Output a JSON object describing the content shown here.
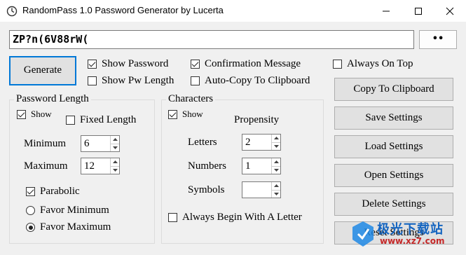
{
  "window": {
    "title": "RandomPass 1.0 Password Generator by Lucerta",
    "icons": [
      "app-icon",
      "minimize-icon",
      "maximize-icon",
      "close-icon"
    ]
  },
  "password": {
    "value": "ZP?n(6V88rW(",
    "reveal_button": "••"
  },
  "actions": {
    "generate": "Generate",
    "copy": "Copy To Clipboard",
    "save": "Save Settings",
    "load": "Load Settings",
    "open": "Open Settings",
    "delete": "Delete Settings",
    "reset": "Reset Settings"
  },
  "options": {
    "show_password": {
      "label": "Show Password",
      "checked": true
    },
    "show_pw_length": {
      "label": "Show Pw Length",
      "checked": false
    },
    "confirmation_message": {
      "label": "Confirmation Message",
      "checked": true
    },
    "auto_copy": {
      "label": "Auto-Copy To Clipboard",
      "checked": false
    },
    "always_on_top": {
      "label": "Always On Top",
      "checked": false
    }
  },
  "password_length": {
    "title": "Password Length",
    "show": {
      "label": "Show",
      "checked": true
    },
    "fixed_length": {
      "label": "Fixed Length",
      "checked": false
    },
    "minimum_label": "Minimum",
    "minimum_value": "6",
    "maximum_label": "Maximum",
    "maximum_value": "12",
    "parabolic": {
      "label": "Parabolic",
      "checked": true
    },
    "favor_minimum": {
      "label": "Favor Minimum",
      "selected": false
    },
    "favor_maximum": {
      "label": "Favor Maximum",
      "selected": true
    }
  },
  "characters": {
    "title": "Characters",
    "show": {
      "label": "Show",
      "checked": true
    },
    "propensity_label": "Propensity",
    "letters_label": "Letters",
    "letters_value": "2",
    "numbers_label": "Numbers",
    "numbers_value": "1",
    "symbols_label": "Symbols",
    "symbols_value": "",
    "always_begin_letter": {
      "label": "Always Begin With A Letter",
      "checked": false
    }
  },
  "watermark": {
    "text": "极光下载站",
    "url": "www.xz7.com"
  },
  "colors": {
    "accent": "#0078d7",
    "window_bg": "#f0f0f0",
    "button_bg": "#e1e1e1"
  }
}
